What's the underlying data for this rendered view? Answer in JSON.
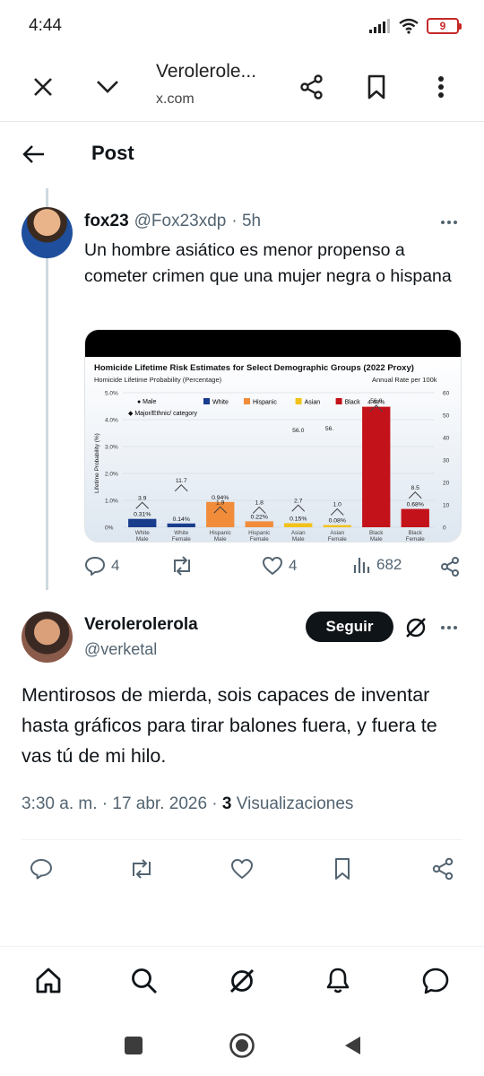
{
  "status_bar": {
    "time": "4:44",
    "battery": "9",
    "icons": [
      "signal-icon",
      "wifi-icon",
      "battery-icon"
    ]
  },
  "browser": {
    "title": "Verolerole...",
    "url": "x.com",
    "icons": [
      "close-icon",
      "chevron-down-icon",
      "share-icon",
      "bookmark-icon",
      "more-vertical-icon"
    ]
  },
  "post_header": {
    "title": "Post",
    "back_icon": "arrow-left-icon"
  },
  "tweet1": {
    "name": "fox23",
    "handle": "@Fox23xdp",
    "time": "· 5h",
    "text": "Un hombre asiático es menor propenso a cometer crimen que una mujer negra o hispana",
    "stats": {
      "replies": "4",
      "retweets": "",
      "likes": "4",
      "views": "682"
    },
    "chart": {
      "title": "Homicide Lifetime Risk Estimates for Select Demographic Groups (2022 Proxy)",
      "subtitle": "Homicide Lifetime Probability (Percentage)",
      "right_label": "Annual Rate per 100k",
      "ylabel": "Lifetime Probability (%)",
      "legend_top": [
        "Male",
        "Major/Ethnic/ category"
      ],
      "legend_groups": [
        "White",
        "Hispanic",
        "Asian",
        "Black"
      ],
      "colors": {
        "White": "#1a3c8c",
        "Hispanic": "#f08c3a",
        "Asian": "#f3c21a",
        "Black": "#c4121a"
      },
      "left_ticks": [
        "5.0%",
        "4.0%",
        "3.0%",
        "2.0%",
        "1.0%",
        "0%"
      ],
      "right_ticks": [
        "60",
        "50",
        "40",
        "30",
        "20",
        "10",
        "0"
      ]
    }
  },
  "chart_data": {
    "type": "bar",
    "title": "Homicide Lifetime Risk Estimates for Select Demographic Groups (2022 Proxy)",
    "subtitle": "Homicide Lifetime Probability (Percentage)",
    "ylabel": "Lifetime Probability (%)",
    "y2label": "Annual Rate per 100k",
    "ylim": [
      0,
      5
    ],
    "y2lim": [
      0,
      60
    ],
    "categories": [
      "White Male",
      "White Female",
      "Hispanic Male",
      "Hispanic Female",
      "Asian Male",
      "Asian Female",
      "Black Male",
      "Black Female"
    ],
    "groups": [
      "White",
      "White",
      "Hispanic",
      "Hispanic",
      "Asian",
      "Asian",
      "Black",
      "Black"
    ],
    "series": [
      {
        "name": "Lifetime Probability (%)",
        "values": [
          0.31,
          0.14,
          0.94,
          0.22,
          0.15,
          0.08,
          4.48,
          0.68
        ],
        "labels": [
          "0.31%",
          "0.14%",
          "0.94%",
          "0.22%",
          "0.15%",
          "0.08%",
          "4.48%",
          "0.68%"
        ]
      },
      {
        "name": "Annual Rate per 100k",
        "values": [
          3.9,
          11.7,
          1.9,
          1.8,
          2.7,
          1.0,
          56.0,
          8.5
        ],
        "labels": [
          "3.9",
          "11.7",
          "1.9",
          "1.8",
          "2.7",
          "1.0",
          "56.0",
          "8.5"
        ]
      }
    ],
    "extra_annotations": [
      "56.0",
      "56."
    ],
    "legend": "top-left",
    "grid": true
  },
  "tweet2": {
    "name": "Verolerolerola",
    "handle": "@verketal",
    "follow_label": "Seguir",
    "text": "Mentirosos de mierda, sois capaces de inventar hasta gráficos para tirar balones fuera, y fuera te vas tú de mi hilo.",
    "meta_time": "3:30 a. m. · 17 abr. 2026 ·",
    "meta_views_count": "3",
    "meta_views_label": "Visualizaciones"
  },
  "bottom_nav": [
    "home-icon",
    "search-icon",
    "grok-icon",
    "notifications-icon",
    "messages-icon"
  ],
  "system_nav": [
    "recents-icon",
    "home-circle-icon",
    "back-triangle-icon"
  ]
}
